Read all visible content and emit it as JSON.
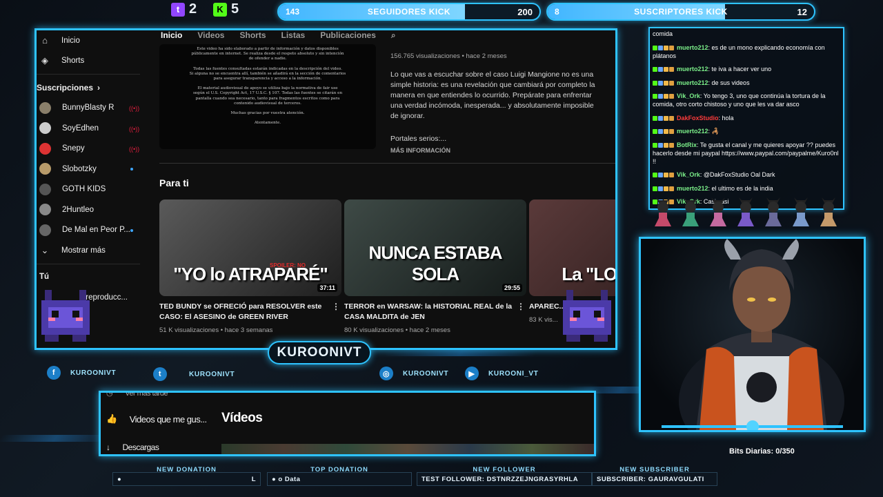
{
  "top": {
    "twitch_count": "2",
    "kick_count": "5",
    "followers_bar": {
      "label": "SEGUIDORES KICK",
      "current": "143",
      "goal": "200",
      "progress": 0.715
    },
    "subs_bar": {
      "label": "SUSCRIPTORES KICK",
      "current": "8",
      "goal": "12",
      "progress": 0.667
    }
  },
  "youtube": {
    "tabs": [
      "Inicio",
      "Videos",
      "Shorts",
      "Listas",
      "Publicaciones"
    ],
    "sidebar": {
      "home": "Inicio",
      "shorts": "Shorts",
      "subs_header": "Suscripciones",
      "channels": [
        "BunnyBlasty R",
        "SoyEdhen",
        "Snepy",
        "Slobotzky",
        "GOTH KIDS",
        "2Huntleo",
        "De Mal en Peor P..."
      ],
      "more": "Mostrar más",
      "you": "Tú",
      "history_partial": "reproducc..."
    },
    "top_video_text": [
      "Este video ha sido elaborado a partir de información y datos disponibles",
      "públicamente en internet. Se realiza desde el respeto absoluto y sin intención",
      "de ofender a nadie.",
      "",
      "Todas las fuentes consultadas estarán indicadas en la descripción del video.",
      "Si alguna no se encuentra allí, también se añadirá en la sección de comentarios",
      "para asegurar transparencia y acceso a la información.",
      "",
      "El material audiovisual de apoyo se utiliza bajo la normativa de fair use",
      "según el U.S. Copyright Act, 17 U.S.C. § 107. Todas las fuentes se citarán en",
      "pantalla cuando sea necesario, tanto para fragmentos escritos como para",
      "contenido audiovisual de terceros.",
      "",
      "Muchas gracias por vuestra atención.",
      "",
      "Atentamente."
    ],
    "top_video_meta": "156.765 visualizaciones • hace 2 meses",
    "top_video_desc": "Lo que vas a escuchar sobre el caso Luigi Mangione no es una simple historia: es una revelación que cambiará por completo la manera en que entiendes lo ocurrido. Prepárate para enfrentar una verdad incómoda, inesperada... y absolutamente imposible de ignorar.",
    "top_video_extra": "Portales serios:...",
    "more_info": "MÁS INFORMACIÓN",
    "section_title": "Para ti",
    "videos": [
      {
        "thumb_text": "\"YO lo ATRAPARÉ\"",
        "spoiler": "SPOILER: NO",
        "duration": "37:11",
        "title": "TED BUNDY se OFRECIÓ para RESOLVER este CASO: El ASESINO de GREEN RIVER",
        "meta": "51 K visualizaciones • hace 3 semanas",
        "color_a": "#5a5a5a",
        "color_b": "#1e1e1e"
      },
      {
        "thumb_text": "NUNCA ESTABA SOLA",
        "spoiler": "",
        "duration": "29:55",
        "title": "TERROR en WARSAW: la HISTORIAL REAL de la CASA MALDITA de JEN",
        "meta": "80 K visualizaciones • hace 2 meses",
        "color_a": "#3e4a46",
        "color_b": "#141a19"
      },
      {
        "thumb_text": "La \"LO...ITA de",
        "spoiler": "",
        "duration": "",
        "title": "APAREC... AMY FISH...",
        "meta": "83 K vis...",
        "color_a": "#5a3a3a",
        "color_b": "#2a1a1a"
      }
    ]
  },
  "chat": [
    {
      "user": "",
      "text": "comida",
      "color": "#ffffff"
    },
    {
      "user": "muerto212",
      "text": ": es de un mono explicando economía con plátanos",
      "color": "#7cf08a"
    },
    {
      "user": "muerto212",
      "text": ": te iva a hacer ver uno",
      "color": "#7cf08a"
    },
    {
      "user": "muerto212",
      "text": ": de sus videos",
      "color": "#7cf08a"
    },
    {
      "user": "Vik_Ork",
      "text": ": Yo tengo 3, uno que continúa la tortura de la comida, otro corto chistoso y uno que les va dar asco",
      "color": "#7cf08a"
    },
    {
      "user": "DakFoxStudio",
      "text": ": hola",
      "color": "#ff3b3b"
    },
    {
      "user": "muerto212",
      "text": ": 🦂",
      "color": "#7cf08a"
    },
    {
      "user": "BotRix",
      "text": ": Te gusta el canal y me quieres apoyar ?? puedes hacerlo desde mi paypal https://www.paypal.com/paypalme/Kuro0nl !!",
      "color": "#7cf08a"
    },
    {
      "user": "Vik_Ork",
      "text": ": @DakFoxStudio Oal Dark",
      "color": "#7cf08a"
    },
    {
      "user": "muerto212",
      "text": ": el ultimo es de la india",
      "color": "#7cf08a"
    },
    {
      "user": "Vik_Ork",
      "text": ": Casi casi",
      "color": "#7cf08a"
    }
  ],
  "bits": {
    "label": "Bits Diarias:",
    "value": "0/350"
  },
  "lower": {
    "row1": "Ver más tarde",
    "row2": "Videos que me gus...",
    "row3": "Descargas",
    "heading": "Vídeos"
  },
  "plate": "KUROONIVT",
  "socials": {
    "facebook": "KUROONIVT",
    "twitter": "KUROONIVT",
    "instagram": "KUROONIVT",
    "youtube": "KUROONI_VT"
  },
  "alerts": [
    {
      "title": "NEW DONATION",
      "body": "L"
    },
    {
      "title": "TOP DONATION",
      "body": "o Data"
    },
    {
      "title": "NEW FOLLOWER",
      "body": "TEST FOLLOWER: DSTNRZZEJNGRASYRHLA"
    },
    {
      "title": "NEW SUBSCRIBER",
      "body": "SUBSCRIBER: GAURAVGULATI"
    }
  ],
  "colors": {
    "accent": "#2ec3ff",
    "twitch": "#9146ff",
    "kick": "#53fc18"
  }
}
